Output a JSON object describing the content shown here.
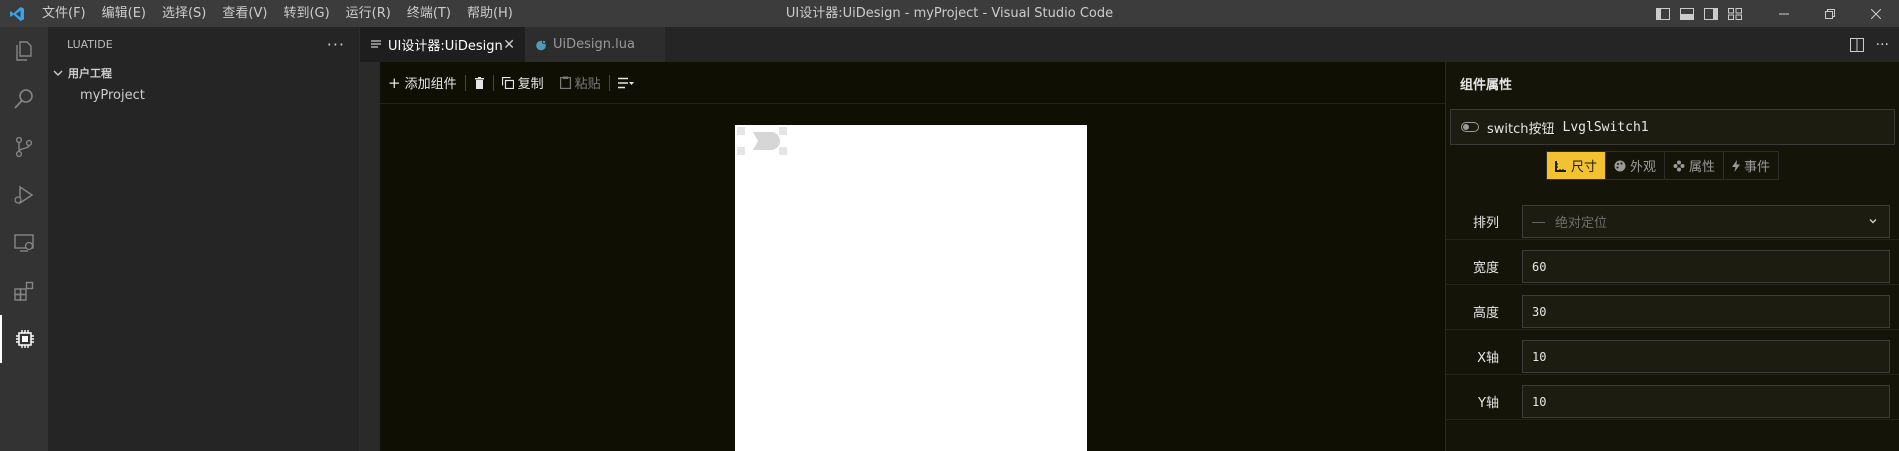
{
  "window": {
    "title": "UI设计器:UiDesign - myProject - Visual Studio Code",
    "menu": [
      "文件(F)",
      "编辑(E)",
      "选择(S)",
      "查看(V)",
      "转到(G)",
      "运行(R)",
      "终端(T)",
      "帮助(H)"
    ]
  },
  "sidebar": {
    "title": "LUATIDE",
    "more": "···",
    "root": "用户工程",
    "child": "myProject"
  },
  "tabs": [
    {
      "label": "UI设计器:UiDesign",
      "close": "✕"
    },
    {
      "label": "UiDesign.lua"
    }
  ],
  "toolbar": {
    "add": "添加组件",
    "copy": "复制",
    "paste": "粘贴"
  },
  "props": {
    "title": "组件属性",
    "component_type": "switch按钮",
    "component_name": "LvglSwitch1",
    "tabs": [
      "尺寸",
      "外观",
      "属性",
      "事件"
    ],
    "layout_label": "排列",
    "layout_value": "绝对定位",
    "width_label": "宽度",
    "width_value": "60",
    "height_label": "高度",
    "height_value": "30",
    "x_label": "X轴",
    "x_value": "10",
    "y_label": "Y轴",
    "y_value": "10"
  },
  "colors": {
    "accent": "#f2c230",
    "titlebar": "#3c3c3c",
    "activitybar": "#333333",
    "sidebar": "#252526",
    "designer_bg": "#0f0f03"
  },
  "icons": [
    "vscode-logo-icon",
    "explorer-icon",
    "search-icon",
    "source-control-icon",
    "run-debug-icon",
    "remote-explorer-icon",
    "extensions-icon",
    "chip-icon"
  ]
}
